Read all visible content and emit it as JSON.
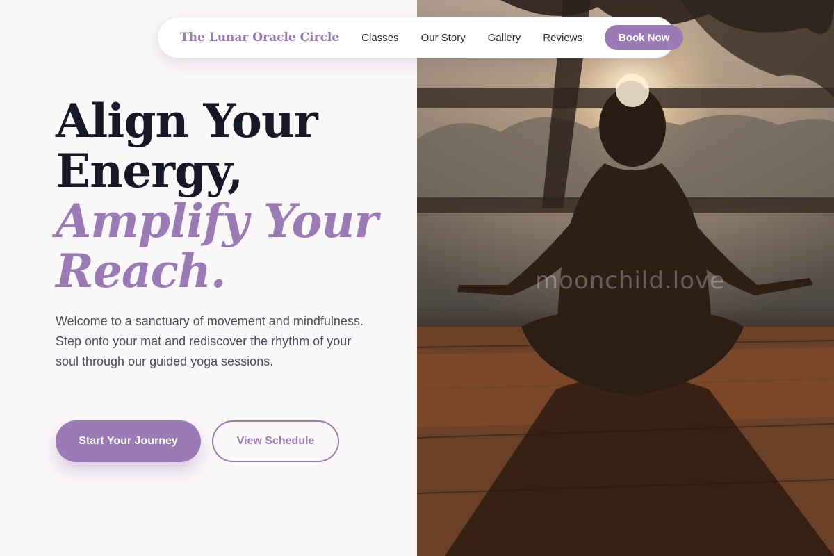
{
  "nav": {
    "brand": "The Lunar Oracle Circle",
    "links": [
      "Classes",
      "Our Story",
      "Gallery",
      "Reviews"
    ],
    "cta": "Book Now"
  },
  "hero": {
    "title_line1": "Align Your",
    "title_line2": "Energy,",
    "title_accent_line1": "Amplify Your",
    "title_accent_line2": "Reach.",
    "description": "Welcome to a sanctuary of movement and mindfulness. Step onto your mat and rediscover the rhythm of your soul through our guided yoga sessions.",
    "primary_button": "Start Your Journey",
    "secondary_button": "View Schedule"
  },
  "image": {
    "watermark": "moonchild.love"
  },
  "colors": {
    "accent": "#9b7bb5",
    "heading": "#161827",
    "body_text": "#4b4d5a",
    "background": "#fbf8fa"
  }
}
